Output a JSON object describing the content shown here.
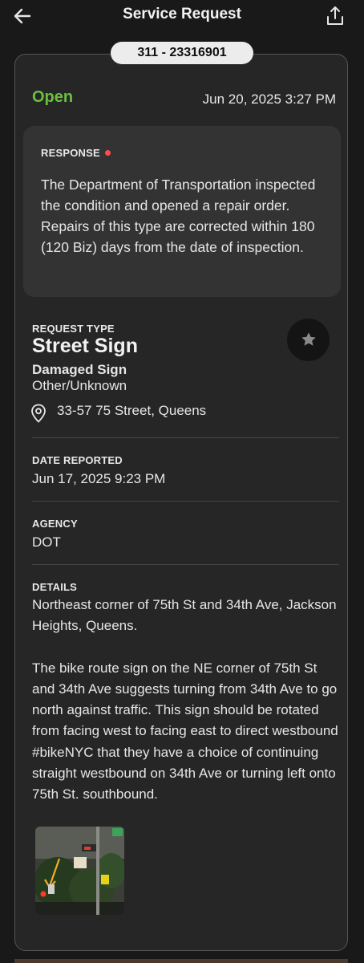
{
  "header": {
    "title": "Service Request",
    "back_icon": "arrow-left-icon",
    "share_icon": "share-icon"
  },
  "request": {
    "number": "311 - 23316901",
    "status": "Open",
    "status_color": "#6cbf3f",
    "created": "Jun 20, 2025 3:27 PM"
  },
  "response": {
    "label": "RESPONSE",
    "indicator_color": "#ff4d4d",
    "text": "The Department of Transportation inspected the condition and opened a repair order. Repairs of this type are corrected within 180 (120 Biz) days from the date of inspection."
  },
  "request_type": {
    "label": "REQUEST TYPE",
    "value": "Street Sign",
    "subtype": "Damaged Sign",
    "descriptor": "Other/Unknown",
    "address": "33-57 75 Street, Queens",
    "favorite_icon": "star-icon"
  },
  "date_reported": {
    "label": "DATE REPORTED",
    "value": "Jun 17, 2025 9:23 PM"
  },
  "agency": {
    "label": "AGENCY",
    "value": "DOT"
  },
  "details": {
    "label": "DETAILS",
    "paragraph1": "Northeast corner of 75th St and 34th Ave, Jackson Heights, Queens.",
    "paragraph2": "The bike route sign on the NE corner of 75th St and 34th Ave suggests turning from 34th Ave to go north against traffic. This sign should be rotated from facing west to facing east to direct westbound #bikeNYC that they have a choice of continuing straight westbound on 34th Ave or turning left onto 75th St. southbound."
  }
}
